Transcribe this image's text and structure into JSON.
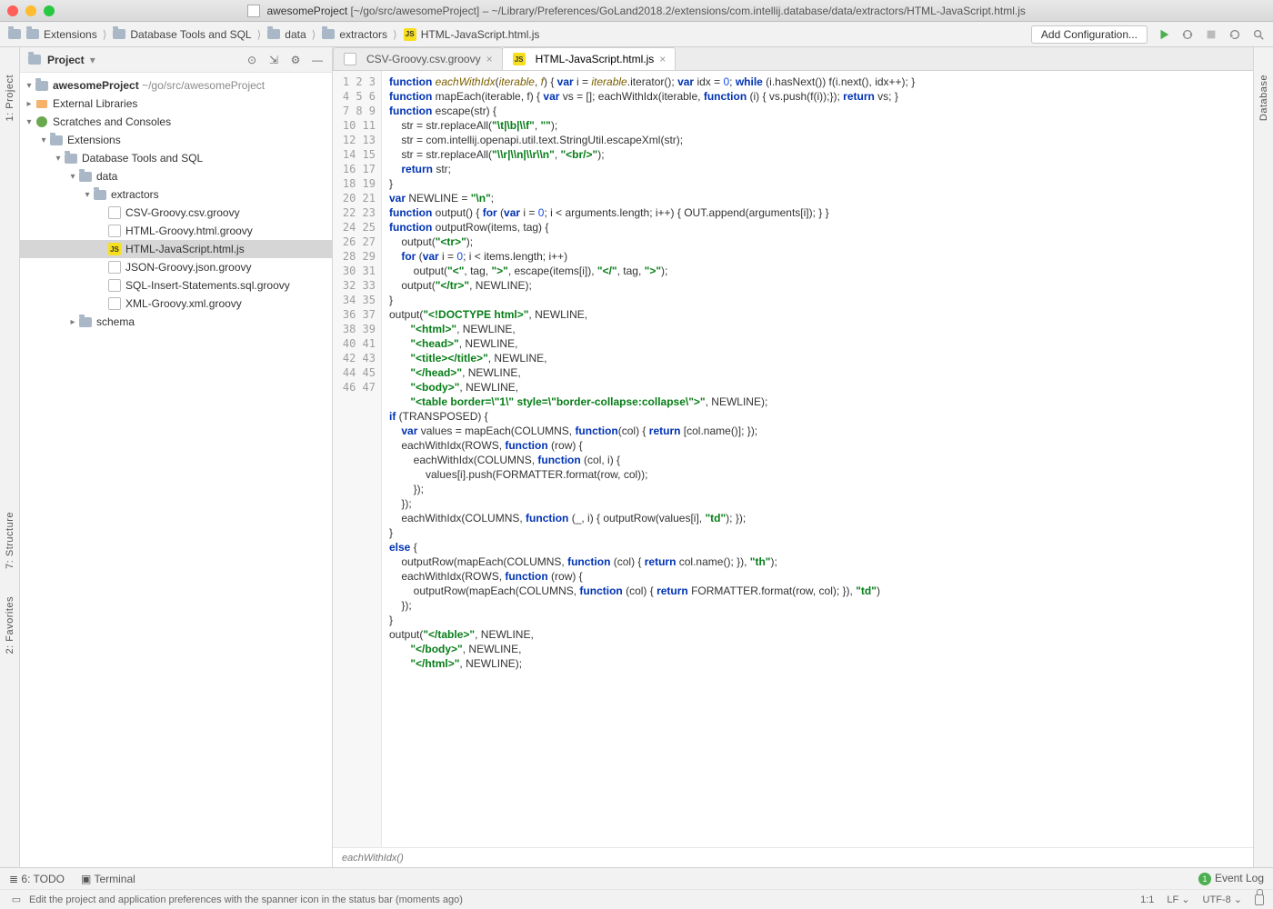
{
  "window": {
    "title_project": "awesomeProject",
    "title_path": "[~/go/src/awesomeProject] – ~/Library/Preferences/GoLand2018.2/extensions/com.intellij.database/data/extractors/HTML-JavaScript.html.js"
  },
  "breadcrumbs": [
    "Extensions",
    "Database Tools and SQL",
    "data",
    "extractors",
    "HTML-JavaScript.html.js"
  ],
  "toolbar": {
    "add_config": "Add Configuration...",
    "run_icon": "run-icon",
    "debug_icon": "debug-icon",
    "stop_icon": "stop-icon",
    "update_icon": "update-icon",
    "search_icon": "search-icon"
  },
  "left_tools": [
    "1: Project",
    "7: Structure",
    "2: Favorites"
  ],
  "right_tools": [
    "Database"
  ],
  "project_panel": {
    "title": "Project",
    "root": {
      "name": "awesomeProject",
      "path": "~/go/src/awesomeProject"
    },
    "ext_libs": "External Libraries",
    "scratches": "Scratches and Consoles",
    "nodes": [
      {
        "indent": 1,
        "tw": "▾",
        "icon": "folder",
        "label": "Extensions"
      },
      {
        "indent": 2,
        "tw": "▾",
        "icon": "folder",
        "label": "Database Tools and SQL"
      },
      {
        "indent": 3,
        "tw": "▾",
        "icon": "folder",
        "label": "data"
      },
      {
        "indent": 4,
        "tw": "▾",
        "icon": "folder",
        "label": "extractors"
      },
      {
        "indent": 5,
        "tw": "",
        "icon": "file",
        "label": "CSV-Groovy.csv.groovy"
      },
      {
        "indent": 5,
        "tw": "",
        "icon": "file",
        "label": "HTML-Groovy.html.groovy"
      },
      {
        "indent": 5,
        "tw": "",
        "icon": "js",
        "label": "HTML-JavaScript.html.js",
        "selected": true
      },
      {
        "indent": 5,
        "tw": "",
        "icon": "file",
        "label": "JSON-Groovy.json.groovy"
      },
      {
        "indent": 5,
        "tw": "",
        "icon": "file",
        "label": "SQL-Insert-Statements.sql.groovy"
      },
      {
        "indent": 5,
        "tw": "",
        "icon": "file",
        "label": "XML-Groovy.xml.groovy"
      },
      {
        "indent": 3,
        "tw": "▸",
        "icon": "folder",
        "label": "schema"
      }
    ]
  },
  "editor": {
    "tabs": [
      {
        "label": "CSV-Groovy.csv.groovy",
        "icon": "file",
        "active": false
      },
      {
        "label": "HTML-JavaScript.html.js",
        "icon": "js",
        "active": true
      }
    ],
    "crumb": "eachWithIdx()",
    "line_count": 47,
    "code_lines": [
      [
        [
          "kw",
          "function"
        ],
        [
          "op",
          " "
        ],
        [
          "fn",
          "eachWithIdx"
        ],
        [
          "op",
          "("
        ],
        [
          "fn",
          "iterable"
        ],
        [
          "op",
          ", "
        ],
        [
          "fn",
          "f"
        ],
        [
          "op",
          ") { "
        ],
        [
          "kw",
          "var"
        ],
        [
          "op",
          " i = "
        ],
        [
          "fn",
          "iterable"
        ],
        [
          "op",
          ".iterator(); "
        ],
        [
          "kw",
          "var"
        ],
        [
          "op",
          " idx = "
        ],
        [
          "num",
          "0"
        ],
        [
          "op",
          "; "
        ],
        [
          "kw",
          "while"
        ],
        [
          "op",
          " (i.hasNext()) f(i.next(), idx++); }"
        ]
      ],
      [
        [
          "kw",
          "function"
        ],
        [
          "op",
          " mapEach(iterable, f) { "
        ],
        [
          "kw",
          "var"
        ],
        [
          "op",
          " vs = []; eachWithIdx(iterable, "
        ],
        [
          "kw",
          "function"
        ],
        [
          "op",
          " (i) { vs.push(f(i));}); "
        ],
        [
          "kw",
          "return"
        ],
        [
          "op",
          " vs; }"
        ]
      ],
      [
        [
          "kw",
          "function"
        ],
        [
          "op",
          " escape(str) {"
        ]
      ],
      [
        [
          "op",
          "    str = str.replaceAll("
        ],
        [
          "str",
          "\"\\t|\\b|\\\\f\""
        ],
        [
          "op",
          ", "
        ],
        [
          "str",
          "\"\""
        ],
        [
          "op",
          ");"
        ]
      ],
      [
        [
          "op",
          "    str = com.intellij.openapi.util.text.StringUtil.escapeXml(str);"
        ]
      ],
      [
        [
          "op",
          "    str = str.replaceAll("
        ],
        [
          "str",
          "\"\\\\r|\\\\n|\\\\r\\\\n\""
        ],
        [
          "op",
          ", "
        ],
        [
          "str",
          "\"<br/>\""
        ],
        [
          "op",
          ");"
        ]
      ],
      [
        [
          "op",
          "    "
        ],
        [
          "kw",
          "return"
        ],
        [
          "op",
          " str;"
        ]
      ],
      [
        [
          "op",
          "}"
        ]
      ],
      [
        [
          "op",
          ""
        ]
      ],
      [
        [
          "kw",
          "var"
        ],
        [
          "op",
          " NEWLINE = "
        ],
        [
          "str",
          "\"\\n\""
        ],
        [
          "op",
          ";"
        ]
      ],
      [
        [
          "op",
          ""
        ]
      ],
      [
        [
          "kw",
          "function"
        ],
        [
          "op",
          " output() { "
        ],
        [
          "kw",
          "for"
        ],
        [
          "op",
          " ("
        ],
        [
          "kw",
          "var"
        ],
        [
          "op",
          " i = "
        ],
        [
          "num",
          "0"
        ],
        [
          "op",
          "; i < arguments.length; i++) { OUT.append(arguments[i]); } }"
        ]
      ],
      [
        [
          "kw",
          "function"
        ],
        [
          "op",
          " outputRow(items, tag) {"
        ]
      ],
      [
        [
          "op",
          "    output("
        ],
        [
          "str",
          "\"<tr>\""
        ],
        [
          "op",
          ");"
        ]
      ],
      [
        [
          "op",
          "    "
        ],
        [
          "kw",
          "for"
        ],
        [
          "op",
          " ("
        ],
        [
          "kw",
          "var"
        ],
        [
          "op",
          " i = "
        ],
        [
          "num",
          "0"
        ],
        [
          "op",
          "; i < items.length; i++)"
        ]
      ],
      [
        [
          "op",
          "        output("
        ],
        [
          "str",
          "\"<\""
        ],
        [
          "op",
          ", tag, "
        ],
        [
          "str",
          "\">\""
        ],
        [
          "op",
          ", escape(items[i]), "
        ],
        [
          "str",
          "\"</\""
        ],
        [
          "op",
          ", tag, "
        ],
        [
          "str",
          "\">\""
        ],
        [
          "op",
          ");"
        ]
      ],
      [
        [
          "op",
          "    output("
        ],
        [
          "str",
          "\"</tr>\""
        ],
        [
          "op",
          ", NEWLINE);"
        ]
      ],
      [
        [
          "op",
          "}"
        ]
      ],
      [
        [
          "op",
          ""
        ]
      ],
      [
        [
          "op",
          ""
        ]
      ],
      [
        [
          "op",
          "output("
        ],
        [
          "str",
          "\"<!DOCTYPE html>\""
        ],
        [
          "op",
          ", NEWLINE,"
        ]
      ],
      [
        [
          "op",
          "       "
        ],
        [
          "str",
          "\"<html>\""
        ],
        [
          "op",
          ", NEWLINE,"
        ]
      ],
      [
        [
          "op",
          "       "
        ],
        [
          "str",
          "\"<head>\""
        ],
        [
          "op",
          ", NEWLINE,"
        ]
      ],
      [
        [
          "op",
          "       "
        ],
        [
          "str",
          "\"<title></title>\""
        ],
        [
          "op",
          ", NEWLINE,"
        ]
      ],
      [
        [
          "op",
          "       "
        ],
        [
          "str",
          "\"</head>\""
        ],
        [
          "op",
          ", NEWLINE,"
        ]
      ],
      [
        [
          "op",
          "       "
        ],
        [
          "str",
          "\"<body>\""
        ],
        [
          "op",
          ", NEWLINE,"
        ]
      ],
      [
        [
          "op",
          "       "
        ],
        [
          "str",
          "\"<table border=\\\"1\\\" style=\\\"border-collapse:collapse\\\">\""
        ],
        [
          "op",
          ", NEWLINE);"
        ]
      ],
      [
        [
          "op",
          ""
        ]
      ],
      [
        [
          "kw",
          "if"
        ],
        [
          "op",
          " (TRANSPOSED) {"
        ]
      ],
      [
        [
          "op",
          "    "
        ],
        [
          "kw",
          "var"
        ],
        [
          "op",
          " values = mapEach(COLUMNS, "
        ],
        [
          "kw",
          "function"
        ],
        [
          "op",
          "(col) { "
        ],
        [
          "kw",
          "return"
        ],
        [
          "op",
          " [col.name()]; });"
        ]
      ],
      [
        [
          "op",
          "    eachWithIdx(ROWS, "
        ],
        [
          "kw",
          "function"
        ],
        [
          "op",
          " (row) {"
        ]
      ],
      [
        [
          "op",
          "        eachWithIdx(COLUMNS, "
        ],
        [
          "kw",
          "function"
        ],
        [
          "op",
          " (col, i) {"
        ]
      ],
      [
        [
          "op",
          "            values[i].push(FORMATTER.format(row, col));"
        ]
      ],
      [
        [
          "op",
          "        });"
        ]
      ],
      [
        [
          "op",
          "    });"
        ]
      ],
      [
        [
          "op",
          "    eachWithIdx(COLUMNS, "
        ],
        [
          "kw",
          "function"
        ],
        [
          "op",
          " (_, i) { outputRow(values[i], "
        ],
        [
          "str",
          "\"td\""
        ],
        [
          "op",
          "); });"
        ]
      ],
      [
        [
          "op",
          "}"
        ]
      ],
      [
        [
          "kw",
          "else"
        ],
        [
          "op",
          " {"
        ]
      ],
      [
        [
          "op",
          "    outputRow(mapEach(COLUMNS, "
        ],
        [
          "kw",
          "function"
        ],
        [
          "op",
          " (col) { "
        ],
        [
          "kw",
          "return"
        ],
        [
          "op",
          " col.name(); }), "
        ],
        [
          "str",
          "\"th\""
        ],
        [
          "op",
          ");"
        ]
      ],
      [
        [
          "op",
          "    eachWithIdx(ROWS, "
        ],
        [
          "kw",
          "function"
        ],
        [
          "op",
          " (row) {"
        ]
      ],
      [
        [
          "op",
          "        outputRow(mapEach(COLUMNS, "
        ],
        [
          "kw",
          "function"
        ],
        [
          "op",
          " (col) { "
        ],
        [
          "kw",
          "return"
        ],
        [
          "op",
          " FORMATTER.format(row, col); }), "
        ],
        [
          "str",
          "\"td\""
        ],
        [
          "op",
          ")"
        ]
      ],
      [
        [
          "op",
          "    });"
        ]
      ],
      [
        [
          "op",
          "}"
        ]
      ],
      [
        [
          "op",
          ""
        ]
      ],
      [
        [
          "op",
          "output("
        ],
        [
          "str",
          "\"</table>\""
        ],
        [
          "op",
          ", NEWLINE,"
        ]
      ],
      [
        [
          "op",
          "       "
        ],
        [
          "str",
          "\"</body>\""
        ],
        [
          "op",
          ", NEWLINE,"
        ]
      ],
      [
        [
          "op",
          "       "
        ],
        [
          "str",
          "\"</html>\""
        ],
        [
          "op",
          ", NEWLINE);"
        ]
      ]
    ]
  },
  "bottom": {
    "todo": "6: TODO",
    "terminal": "Terminal",
    "event_log": "Event Log"
  },
  "status": {
    "hint": "Edit the project and application preferences with the spanner icon in the status bar (moments ago)",
    "pos": "1:1",
    "le": "LF",
    "enc": "UTF-8"
  }
}
